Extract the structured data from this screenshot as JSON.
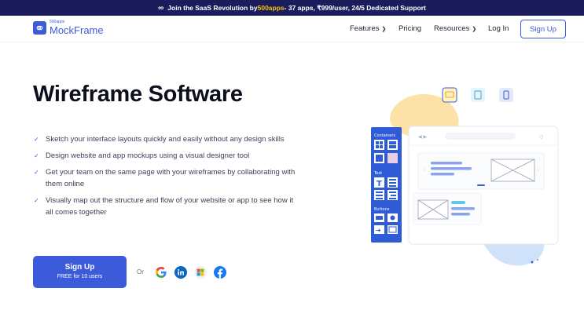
{
  "banner": {
    "prefix": "Join the SaaS Revolution by ",
    "highlight": "500apps",
    "suffix": " - 37 apps, ₹999/user, 24/5 Dedicated Support"
  },
  "nav": {
    "logo_small": "500apps",
    "logo_name": "MockFrame",
    "items": [
      {
        "label": "Features",
        "dropdown": true
      },
      {
        "label": "Pricing",
        "dropdown": false
      },
      {
        "label": "Resources",
        "dropdown": true
      },
      {
        "label": "Log In",
        "dropdown": false
      }
    ],
    "signup": "Sign Up"
  },
  "hero": {
    "title": "Wireframe Software",
    "features": [
      "Sketch your interface layouts quickly and easily without any design skills",
      "Design website and app mockups using a visual designer tool",
      "Get your team on the same page with your wireframes by collaborating with them online",
      "Visually map out the structure and flow of your website or app to see how it all comes together"
    ],
    "cta_label": "Sign Up",
    "cta_sub": "FREE for 10 users",
    "or": "Or",
    "social": [
      "google-icon",
      "linkedin-icon",
      "microsoft-icon",
      "facebook-icon"
    ]
  },
  "illustration": {
    "panel_containers": "Containers",
    "panel_text": "Text",
    "panel_buttons": "Buttons"
  },
  "colors": {
    "brand": "#3b5bdb",
    "banner_bg": "#1a1c5c",
    "banner_highlight": "#f5c400",
    "panel_blue": "#2f5bd6"
  }
}
